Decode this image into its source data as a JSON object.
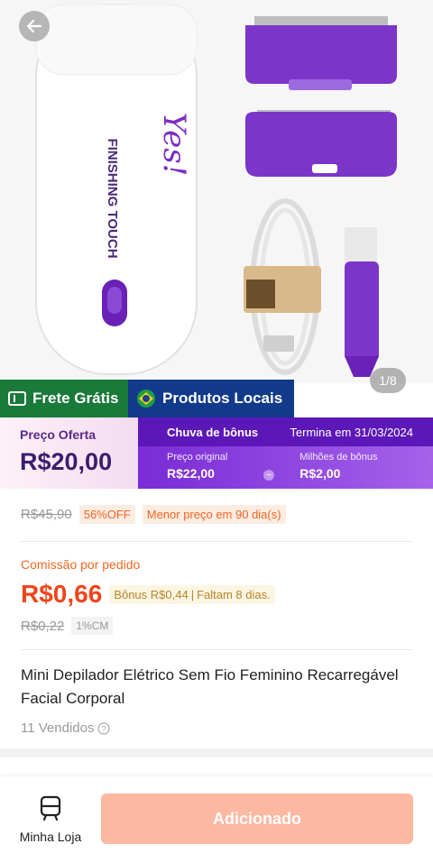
{
  "gallery": {
    "counter": "1/8",
    "brand_text": "FINISHING TOUCH",
    "logo_text": "Yes!"
  },
  "badges": {
    "free_shipping": "Frete Grátis",
    "local_products": "Produtos Locais"
  },
  "offer": {
    "label": "Preço Oferta",
    "price": "R$20,00"
  },
  "bonus": {
    "title": "Chuva de bônus",
    "ends": "Termina em 31/03/2024",
    "original_label": "Preço original",
    "original_value": "R$22,00",
    "miles_label": "Milhões de bônus",
    "miles_value": "R$2,00"
  },
  "pricing": {
    "old_price": "R$45,90",
    "discount": "56%OFF",
    "lowest_note": "Menor preço em 90 dia(s)"
  },
  "commission": {
    "label": "Comissão por pedido",
    "value": "R$0,66",
    "bonus_tag": "Bônus R$0,44",
    "days_left": "Faltam 8 dias.",
    "old_value": "R$0,22",
    "rate": "1%CM"
  },
  "product": {
    "title": "Mini Depilador Elétrico Sem Fio Feminino Recarregável Facial Corporal",
    "sold": "11 Vendidos"
  },
  "bottom_bar": {
    "store_label": "Minha Loja",
    "add_button": "Adicionado"
  },
  "colors": {
    "accent_orange": "#f0441a",
    "bonus_purple": "#7a2bd6",
    "free_green": "#1a7a3a",
    "local_blue": "#123a8a",
    "button_disabled": "#fcb8a0"
  }
}
